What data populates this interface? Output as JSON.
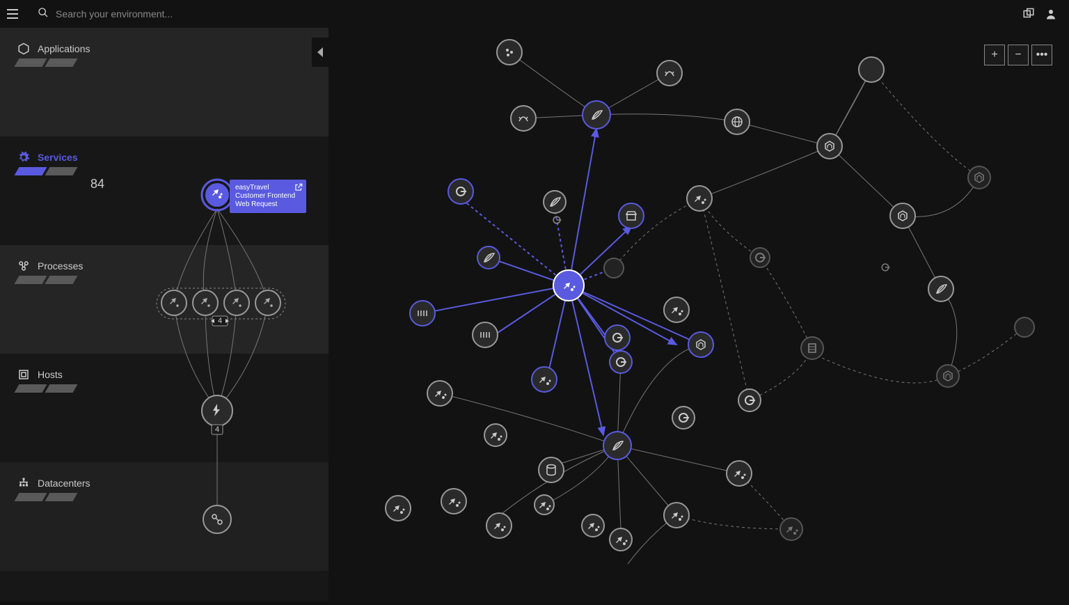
{
  "topbar": {
    "search_placeholder": "Search your environment..."
  },
  "sections": [
    {
      "key": "applications",
      "title": "Applications",
      "active": false,
      "count": ""
    },
    {
      "key": "services",
      "title": "Services",
      "active": true,
      "count": "84"
    },
    {
      "key": "processes",
      "title": "Processes",
      "active": false,
      "count": ""
    },
    {
      "key": "hosts",
      "title": "Hosts",
      "active": false,
      "count": ""
    },
    {
      "key": "datacenters",
      "title": "Datacenters",
      "active": false,
      "count": ""
    }
  ],
  "selected_node": {
    "label": "easyTravel Customer Frontend Web Request"
  },
  "stack": {
    "process_count_badge": "4",
    "host_count_badge": "4"
  },
  "zoom": {
    "in": "+",
    "out": "−",
    "more": "•••"
  },
  "colors": {
    "accent": "#5a5ae0",
    "bg_dark": "#121212",
    "bg_panel": "#171717"
  }
}
